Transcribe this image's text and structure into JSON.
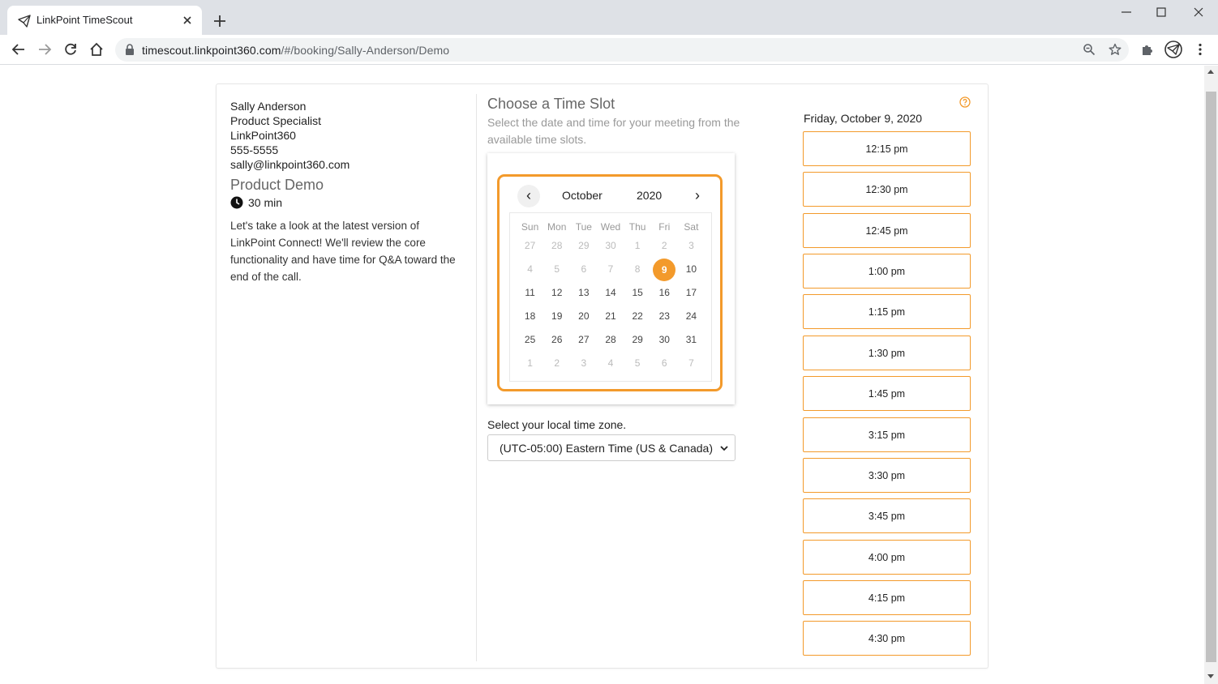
{
  "browser": {
    "tab_title": "LinkPoint TimeScout",
    "url_host": "timescout.linkpoint360.com",
    "url_path": "/#/booking/Sally-Anderson/Demo"
  },
  "host": {
    "name": "Sally Anderson",
    "title": "Product Specialist",
    "company": "LinkPoint360",
    "phone": "555-5555",
    "email": "sally@linkpoint360.com"
  },
  "event": {
    "title": "Product Demo",
    "duration": "30 min",
    "description": "Let's take a look at the latest version of LinkPoint Connect! We'll review the core functionality and have time for Q&A toward the end of the call."
  },
  "picker": {
    "title": "Choose a Time Slot",
    "subtitle": "Select the date and time for your meeting from the available time slots.",
    "prev_label": "‹",
    "next_label": "›",
    "month": "October",
    "year": "2020",
    "weekdays": [
      "Sun",
      "Mon",
      "Tue",
      "Wed",
      "Thu",
      "Fri",
      "Sat"
    ],
    "weeks": [
      [
        "27",
        "28",
        "29",
        "30",
        "1",
        "2",
        "3"
      ],
      [
        "4",
        "5",
        "6",
        "7",
        "8",
        "9",
        "10"
      ],
      [
        "11",
        "12",
        "13",
        "14",
        "15",
        "16",
        "17"
      ],
      [
        "18",
        "19",
        "20",
        "21",
        "22",
        "23",
        "24"
      ],
      [
        "25",
        "26",
        "27",
        "28",
        "29",
        "30",
        "31"
      ],
      [
        "1",
        "2",
        "3",
        "4",
        "5",
        "6",
        "7"
      ]
    ],
    "selected_day": "9",
    "timezone_label": "Select your local time zone.",
    "timezone_value": "(UTC-05:00) Eastern Time (US & Canada)"
  },
  "slots": {
    "selected_date": "Friday, October 9, 2020",
    "times": [
      "12:15 pm",
      "12:30 pm",
      "12:45 pm",
      "1:00 pm",
      "1:15 pm",
      "1:30 pm",
      "1:45 pm",
      "3:15 pm",
      "3:30 pm",
      "3:45 pm",
      "4:00 pm",
      "4:15 pm",
      "4:30 pm"
    ]
  },
  "colors": {
    "accent": "#f39a2b"
  }
}
